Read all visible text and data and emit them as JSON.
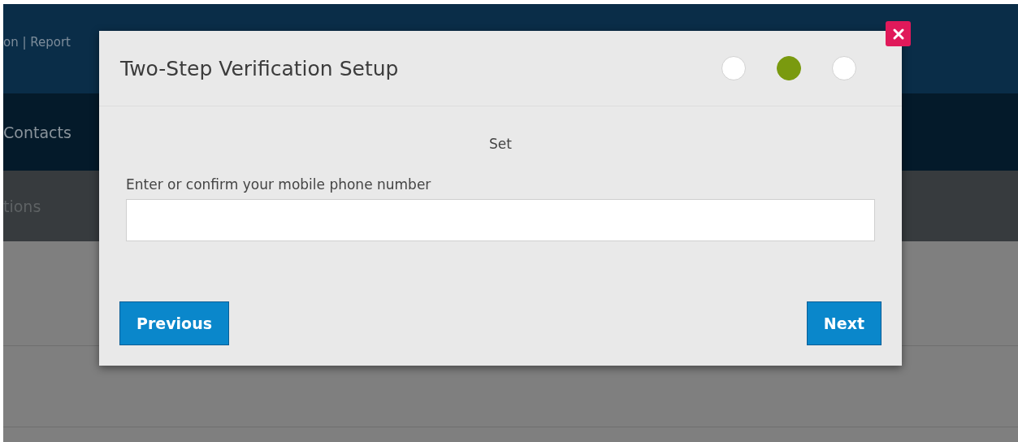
{
  "page": {
    "header_links": "on | Report",
    "nav_item": "Contacts",
    "subnav_item": "tions"
  },
  "dialog": {
    "title": "Two-Step Verification Setup",
    "steps": [
      {
        "selected": false
      },
      {
        "selected": true
      },
      {
        "selected": false
      }
    ],
    "step_label": "Set",
    "field": {
      "label": "Enter or confirm your mobile phone number"
    },
    "buttons": [
      {
        "label": "Previous",
        "kind": "previous"
      },
      {
        "label": "Next",
        "kind": "next"
      }
    ]
  }
}
